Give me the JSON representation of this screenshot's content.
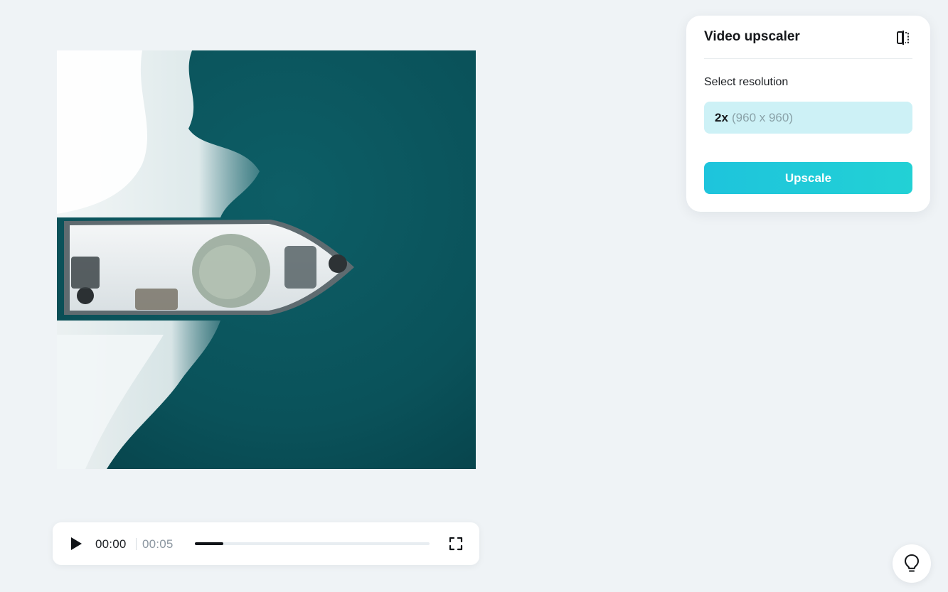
{
  "video": {
    "description_icon": "video-preview"
  },
  "player": {
    "play_icon": "play-icon",
    "current_time": "00:00",
    "total_time": "00:05",
    "progress": 0.12,
    "fullscreen_icon": "fullscreen-icon"
  },
  "panel": {
    "title": "Video upscaler",
    "compare_icon": "compare-icon",
    "resolution_label": "Select resolution",
    "resolution": {
      "scale": "2x",
      "dimensions": "(960 x 960)"
    },
    "upscale_label": "Upscale"
  },
  "help": {
    "icon": "lightbulb-icon"
  },
  "colors": {
    "accent": "#1ec4dc",
    "select_bg": "#cdf1f6",
    "page_bg": "#eff3f6",
    "water": "#0b5159"
  }
}
